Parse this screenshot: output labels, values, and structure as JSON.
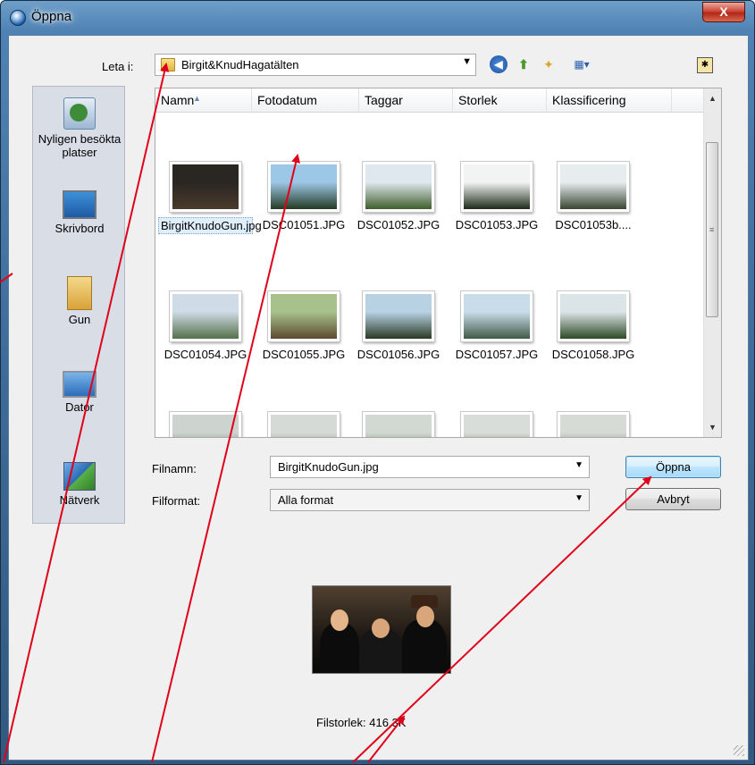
{
  "window": {
    "title": "Öppna",
    "close_glyph": "X"
  },
  "lookin": {
    "label": "Leta i:",
    "value": "Birgit&KnudHagatälten",
    "arrow": "▼"
  },
  "toolbar": {
    "back_glyph": "◀",
    "up_glyph": "⬆",
    "newfolder_glyph": "✦",
    "view_glyph": "▦▾",
    "extra_glyph": "✱"
  },
  "places": [
    {
      "label": "Nyligen besökta platser",
      "icon": "recent-places-icon"
    },
    {
      "label": "Skrivbord",
      "icon": "desktop-icon"
    },
    {
      "label": "Gun",
      "icon": "user-folder-icon"
    },
    {
      "label": "Dator",
      "icon": "computer-icon"
    },
    {
      "label": "Nätverk",
      "icon": "network-icon"
    }
  ],
  "columns": [
    "Namn",
    "Fotodatum",
    "Taggar",
    "Storlek",
    "Klassificering"
  ],
  "files": [
    {
      "name": "BirgitKnudoGun.jpg",
      "color_top": "#2a2622",
      "color_bottom": "#4a3b2c"
    },
    {
      "name": "DSC01051.JPG",
      "color_top": "#9cc7e6",
      "color_bottom": "#243a22"
    },
    {
      "name": "DSC01052.JPG",
      "color_top": "#dfe8ee",
      "color_bottom": "#3f5e2c"
    },
    {
      "name": "DSC01053.JPG",
      "color_top": "#f2f4f4",
      "color_bottom": "#1e2a18"
    },
    {
      "name": "DSC01053b....",
      "color_top": "#e7ecef",
      "color_bottom": "#3b4632"
    },
    {
      "name": "DSC01054.JPG",
      "color_top": "#cfdbe6",
      "color_bottom": "#55704a"
    },
    {
      "name": "DSC01055.JPG",
      "color_top": "#a8c18c",
      "color_bottom": "#5b4a2e"
    },
    {
      "name": "DSC01056.JPG",
      "color_top": "#b8d2e4",
      "color_bottom": "#2b3a24"
    },
    {
      "name": "DSC01057.JPG",
      "color_top": "#c9dcea",
      "color_bottom": "#405a48"
    },
    {
      "name": "DSC01058.JPG",
      "color_top": "#dbe4e6",
      "color_bottom": "#2e4a26"
    },
    {
      "name": "",
      "color_top": "#cdd3cf",
      "color_bottom": "#5d6b4f"
    },
    {
      "name": "",
      "color_top": "#d5dad6",
      "color_bottom": "#6c7660"
    },
    {
      "name": "",
      "color_top": "#d2d8d2",
      "color_bottom": "#5c6e4d"
    },
    {
      "name": "",
      "color_top": "#d9ddd9",
      "color_bottom": "#4f6a40"
    },
    {
      "name": "",
      "color_top": "#d6dbd6",
      "color_bottom": "#5f6f50"
    }
  ],
  "form": {
    "filename_label": "Filnamn:",
    "filename_value": "BirgitKnudoGun.jpg",
    "format_label": "Filformat:",
    "format_value": "Alla format",
    "dropdown_arrow": "▼",
    "open_label": "Öppna",
    "cancel_label": "Avbryt"
  },
  "scrollbar": {
    "up_glyph": "▲",
    "down_glyph": "▼",
    "grip_glyph": "≡"
  },
  "preview": {
    "filesize": "Filstorlek: 416,3K"
  },
  "colors": {
    "accent": "#3c7fb1",
    "annotation": "#e0001a",
    "title_bar": "#4f82b4"
  }
}
